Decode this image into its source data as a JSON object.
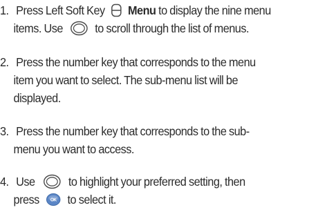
{
  "steps": [
    {
      "number": "1.",
      "line1_a": "Press Left Soft Key",
      "line1_menu": "Menu",
      "line1_b": "to display the nine menu",
      "line2_a": "items. Use",
      "line2_b": "to scroll through the list of menus."
    },
    {
      "number": "2.",
      "line1": "Press the number key that corresponds to the menu",
      "line2": "item you want to select. The sub-menu list will be",
      "line3": "displayed."
    },
    {
      "number": "3.",
      "line1": "Press the number key that corresponds to the sub-",
      "line2": "menu you want to access."
    },
    {
      "number": "4.",
      "line1_a": "Use",
      "line1_b": "to highlight your preferred setting, then",
      "line2_a": "press",
      "line2_b": "to select it."
    }
  ],
  "icons": {
    "left_soft_key": "left-soft-key-icon",
    "navigation_key": "navigation-key-icon",
    "ok_key": "ok-key-icon"
  },
  "colors": {
    "text": "#2b2b2b",
    "icon_stroke": "#4a4a4a",
    "ok_key_fill": "#5b86c6"
  }
}
